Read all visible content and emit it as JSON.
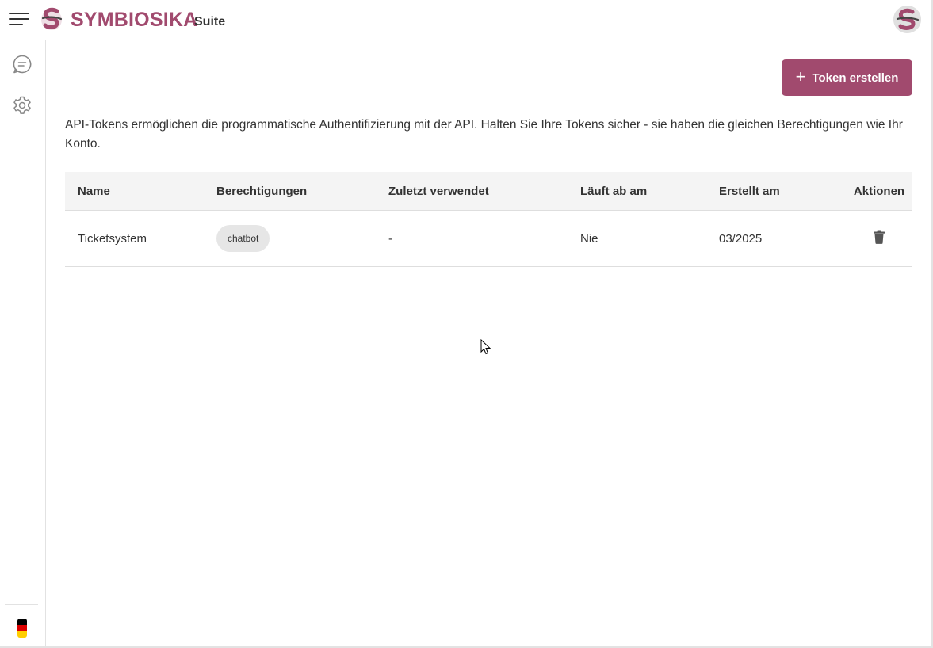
{
  "header": {
    "brand": "SYMBIOSIKA",
    "brand_suffix": "Suite",
    "menu_icon": "hamburger-menu-icon",
    "logo_icon": "symbiosika-logo-icon",
    "avatar_icon": "user-avatar-icon"
  },
  "sidebar": {
    "items": [
      {
        "icon": "chat-icon"
      },
      {
        "icon": "gear-icon"
      }
    ],
    "language_icon": "german-flag-icon"
  },
  "main": {
    "create_button": {
      "label": "Token erstellen",
      "icon": "plus-icon"
    },
    "description": "API-Tokens ermöglichen die programmatische Authentifizierung mit der API. Halten Sie Ihre Tokens sicher - sie haben die gleichen Berechtigungen wie Ihr Konto.",
    "table": {
      "headers": [
        "Name",
        "Berechtigungen",
        "Zuletzt verwendet",
        "Läuft ab am",
        "Erstellt am",
        "Aktionen"
      ],
      "rows": [
        {
          "name": "Ticketsystem",
          "permission": "chatbot",
          "last_used": "-",
          "expires": "Nie",
          "created": "03/2025",
          "action_icon": "trash-icon"
        }
      ]
    }
  },
  "colors": {
    "accent": "#a14a6e",
    "text": "#333333",
    "header_bg": "#f4f4f4"
  }
}
